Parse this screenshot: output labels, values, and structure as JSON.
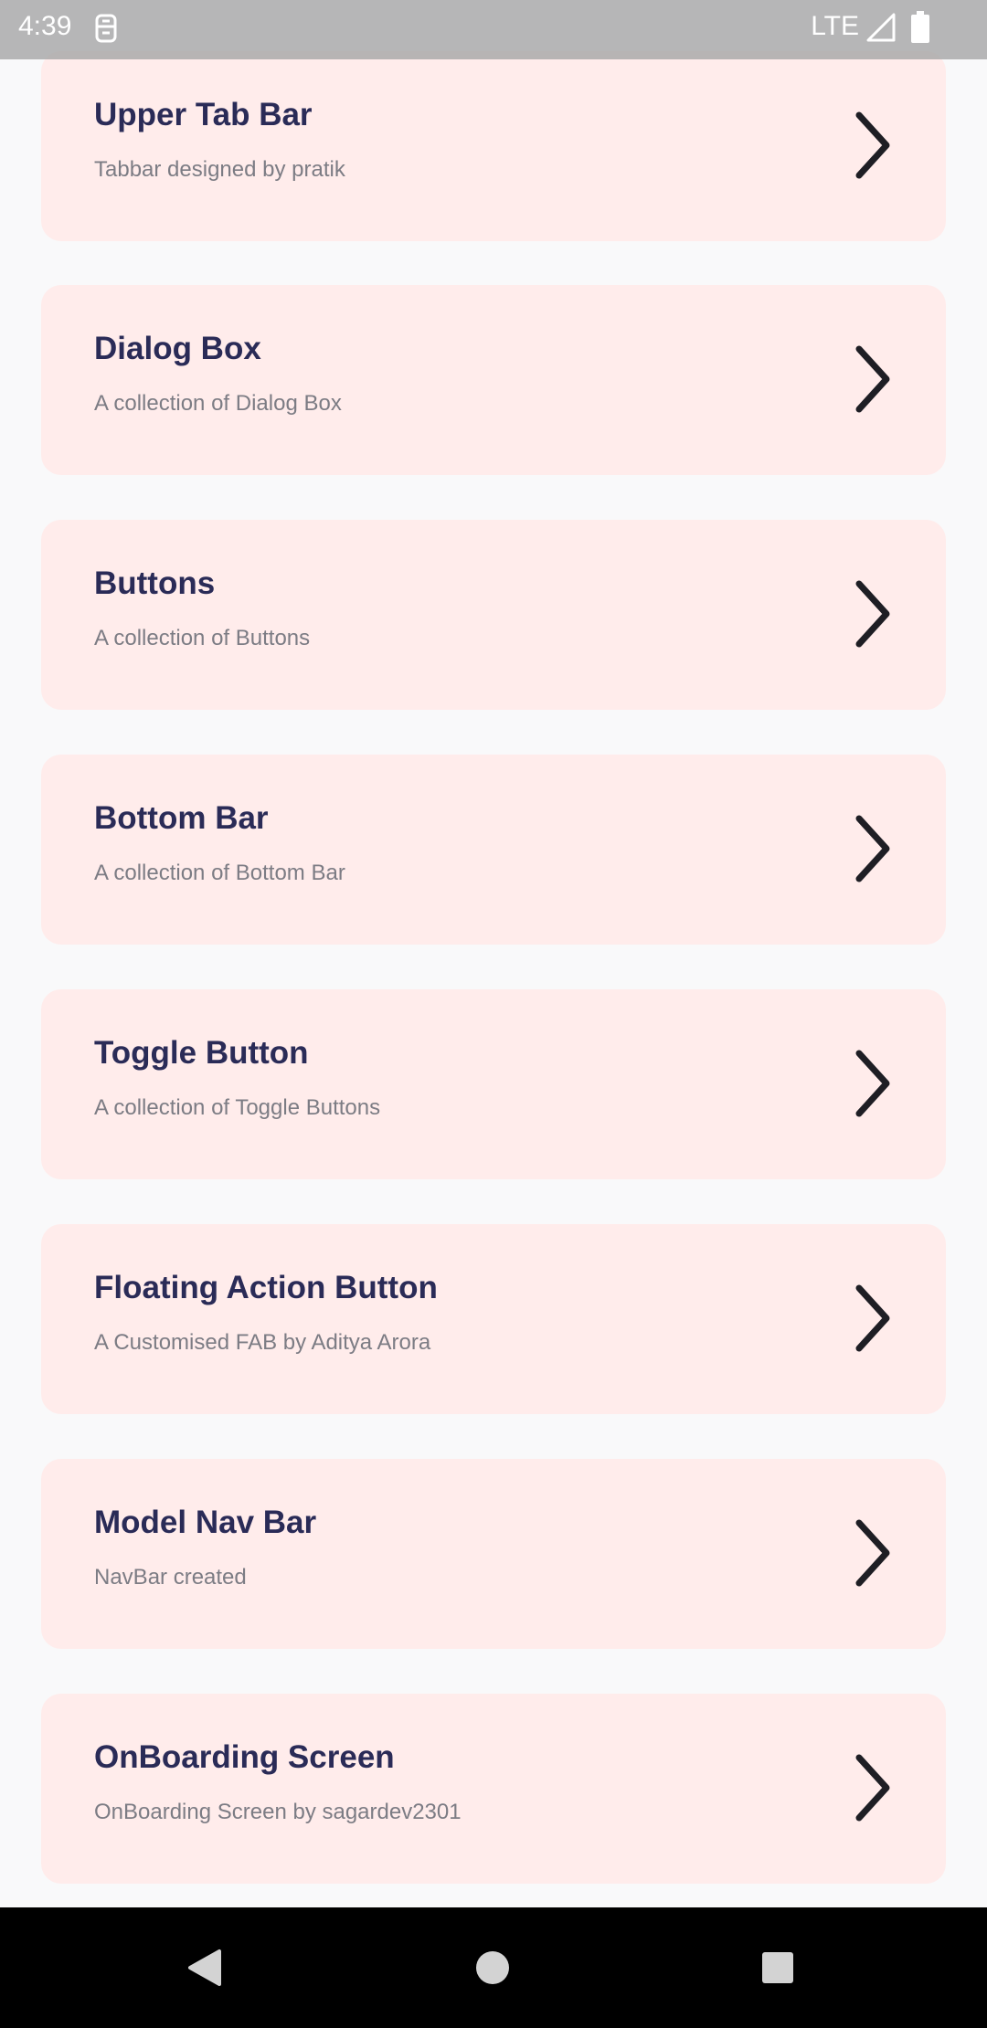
{
  "status_bar": {
    "time": "4:39",
    "network": "LTE",
    "icons": [
      "sim-card-icon",
      "signal-icon",
      "battery-icon"
    ]
  },
  "items": [
    {
      "title": "Upper Tab Bar",
      "subtitle": "Tabbar designed by pratik"
    },
    {
      "title": "Dialog Box",
      "subtitle": "A collection of Dialog Box"
    },
    {
      "title": "Buttons",
      "subtitle": "A collection of Buttons"
    },
    {
      "title": "Bottom Bar",
      "subtitle": "A collection of Bottom Bar"
    },
    {
      "title": "Toggle Button",
      "subtitle": "A collection of Toggle Buttons"
    },
    {
      "title": "Floating Action Button",
      "subtitle": "A Customised FAB by Aditya Arora"
    },
    {
      "title": "Model Nav Bar",
      "subtitle": "NavBar created"
    },
    {
      "title": "OnBoarding Screen",
      "subtitle": "OnBoarding Screen by sagardev2301"
    }
  ],
  "colors": {
    "card_background": "#ffeceb",
    "title": "#2a2b57",
    "subtitle": "#7c7c84",
    "page_background": "#f9f9fa"
  },
  "nav_bar": {
    "buttons": [
      "back-icon",
      "home-icon",
      "recents-icon"
    ]
  }
}
